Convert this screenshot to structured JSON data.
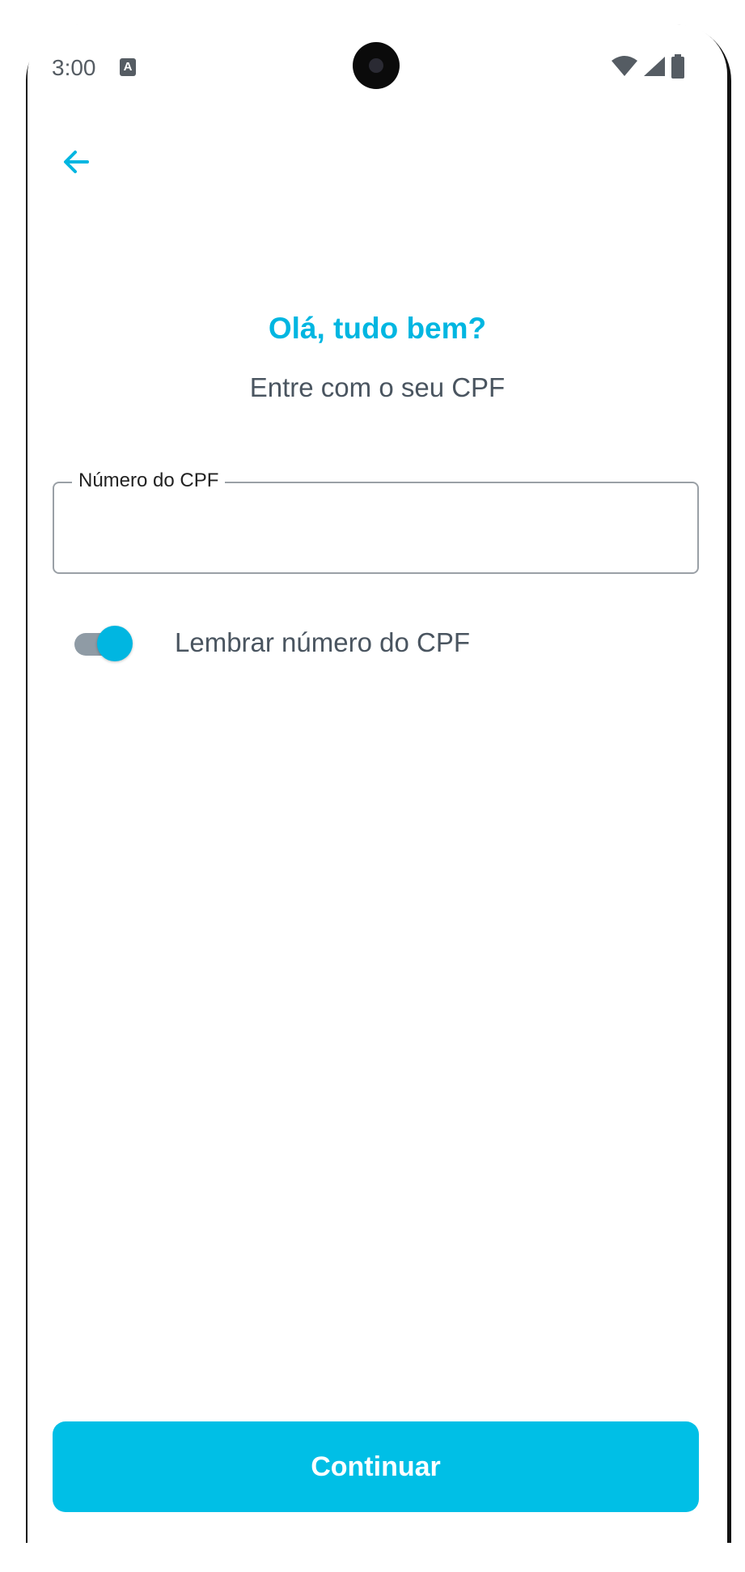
{
  "status_bar": {
    "time": "3:00",
    "notification_icon": "a-keyboard-icon",
    "icons": [
      "wifi-icon",
      "signal-icon",
      "battery-icon"
    ]
  },
  "header": {
    "back_icon": "arrow-left-icon"
  },
  "main": {
    "greeting": "Olá, tudo bem?",
    "subtitle": "Entre com o seu CPF",
    "cpf_field": {
      "label": "Número do CPF",
      "value": ""
    },
    "remember": {
      "label": "Lembrar número do CPF",
      "enabled": true
    }
  },
  "footer": {
    "continue_label": "Continuar"
  },
  "colors": {
    "accent": "#00b6e1",
    "button": "#00bfe6",
    "text": "#4a5560",
    "toggle_track": "#8f9ba5"
  }
}
